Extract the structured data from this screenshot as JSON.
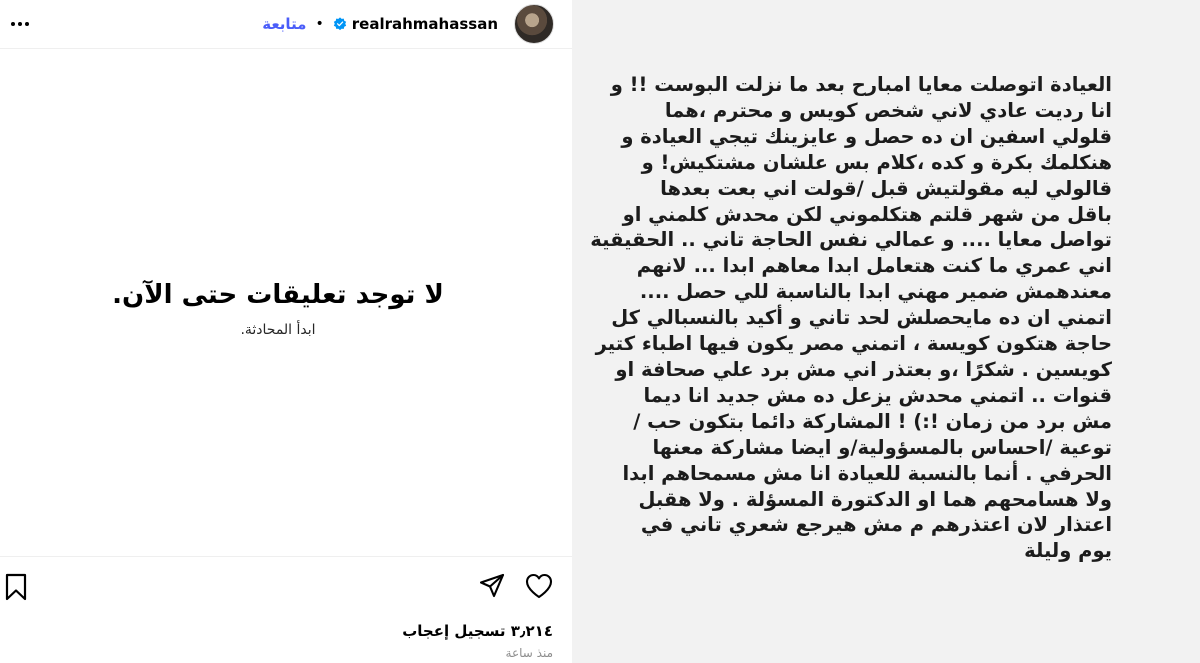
{
  "header": {
    "username": "realrahmahassan",
    "follow_label": "متابعة",
    "separator": "•",
    "more_icon": "more-horizontal-icon",
    "verified_icon": "verified-badge-icon"
  },
  "comments": {
    "empty_title": "لا توجد تعليقات حتى الآن.",
    "empty_subtitle": "ابدأ المحادثة."
  },
  "actions": {
    "like_icon": "heart-icon",
    "share_icon": "send-icon",
    "save_icon": "bookmark-icon",
    "likes_label": "٣٫٢١٤ تسجيل إعجاب",
    "timestamp": "منذ ساعة"
  },
  "post_image_text": {
    "lines": [
      "العيادة اتوصلت معايا امبارح بعد ما نزلت البوست !! و",
      "انا رديت عادي لاني شخص كويس و محترم ،هما",
      "قلولي اسفين ان ده حصل و عايزينك تيجي العيادة و",
      "هنكلمك بكرة و كده ،كلام بس علشان مشتكيش! و",
      "قالولي ليه مقولتيش قبل /قولت اني بعت بعدها",
      "باقل من شهر قلتم هتكلموني لكن محدش كلمني او",
      "تواصل معايا .... و عمالي نفس الحاجة تاني .. الحقيقية",
      "اني عمري ما كنت هتعامل ابدا معاهم ابدا ... لانهم",
      "معندهمش ضمير مهني ابدا بالناسبة للي حصل ....",
      "اتمني ان ده مايحصلش لحد تاني و أكيد بالنسبالي كل",
      "حاجة هتكون كويسة ، اتمني مصر يكون فيها اطباء كتير",
      "كويسين . شكرًا ،و بعتذر اني مش برد علي صحافة او",
      "قنوات .. اتمني محدش يزعل ده مش جديد انا ديما",
      "مش برد من زمان !:) ! المشاركة دائما بتكون حب /",
      "توعية /احساس بالمسؤولية/و ايضا مشاركة معنها",
      "الحرفي . أنما بالنسبة للعيادة انا مش مسمحاهم ابدا",
      "ولا هسامحهم هما او الدكتورة المسؤلة . ولا هقبل",
      "اعتذار لان اعتذرهم م مش هيرجع شعري تاني في",
      "يوم وليلة"
    ]
  },
  "colors": {
    "follow": "#4a5df9",
    "verified": "#0095f6",
    "image_background": "#f2f2f2",
    "muted_text": "#8e8e8e"
  }
}
